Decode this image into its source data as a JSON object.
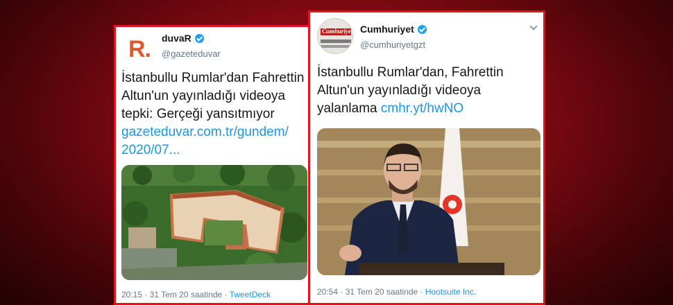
{
  "tweets": [
    {
      "avatar_letter": "R.",
      "display_name": "duvaR",
      "handle": "@gazeteduvar",
      "text": "İstanbullu Rumlar'dan Fahrettin Altun'un yayınladığı videoya tepki: Gerçeği yansıtmıyor ",
      "link": "gazeteduvar.com.tr/gundem/ 2020/07...",
      "time": "20:15 · 31 Tem 20 saatinde · ",
      "source": "TweetDeck",
      "media_icon": "aerial-photo-icon"
    },
    {
      "avatar_logo": "Cumhuriyet",
      "display_name": "Cumhuriyet",
      "handle": "@cumhuriyetgzt",
      "text": "İstanbullu Rumlar'dan, Fahrettin Altun'un yayınladığı videoya yalanlama ",
      "link": "cmhr.yt/hwNO",
      "time": "20:54 · 31 Tem 20 saatinde · ",
      "source": "Hootsuite Inc.",
      "media_icon": "speaker-photo-icon"
    }
  ],
  "colors": {
    "frame_border": "#e0141e",
    "link": "#1b95e0",
    "verified": "#1da1f2",
    "background_red": "#b3101c"
  }
}
